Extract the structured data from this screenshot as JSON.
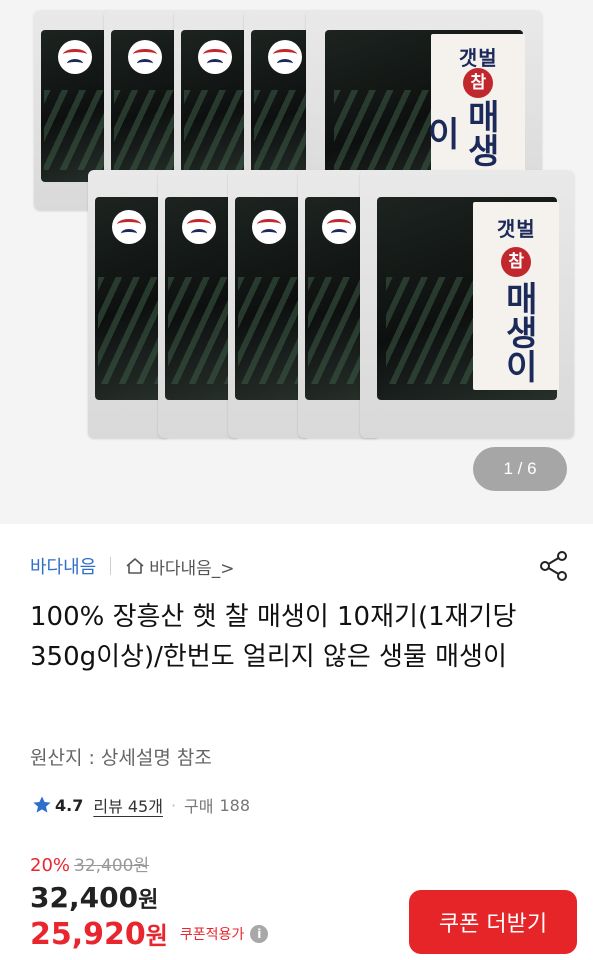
{
  "gallery": {
    "counter": "1 / 6",
    "pack_brand": "갯벌",
    "pack_seal": "참",
    "pack_name": "매생이"
  },
  "seller": {
    "name": "바다내음",
    "store_link": "바다내음_>"
  },
  "product": {
    "title": "100% 장흥산 햇 찰 매생이 10재기(1재기당 350g이상)/한번도 얼리지 않은 생물 매생이",
    "origin": "원산지 : 상세설명 참조"
  },
  "rating": {
    "score": "4.7",
    "reviews": "리뷰 45개",
    "separator": "·",
    "purchase_label": "구매",
    "purchase_count": "188"
  },
  "price": {
    "discount_rate": "20%",
    "original": "32,400원",
    "sale_amount": "32,400",
    "sale_unit": "원",
    "coupon_amount": "25,920",
    "coupon_unit": "원",
    "coupon_label": "쿠폰적용가"
  },
  "actions": {
    "coupon_button": "쿠폰 더받기"
  },
  "colors": {
    "accent_red": "#e52528",
    "seller_blue": "#2f6ecb",
    "star_blue": "#2f6ecb"
  }
}
